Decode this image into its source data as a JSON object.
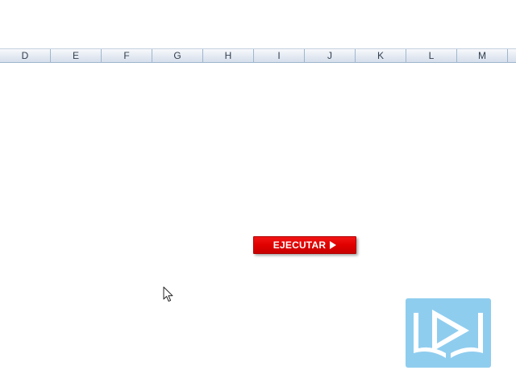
{
  "spreadsheet": {
    "column_headers": [
      "D",
      "E",
      "F",
      "G",
      "H",
      "I",
      "J",
      "K",
      "L",
      "M"
    ]
  },
  "run_button": {
    "label": "EJECUTAR",
    "icon": "play-icon",
    "color": "#e00000"
  },
  "cursor": {
    "icon": "mouse-pointer-icon"
  },
  "logo": {
    "icon": "book-play-logo",
    "color": "#8fcdef"
  }
}
